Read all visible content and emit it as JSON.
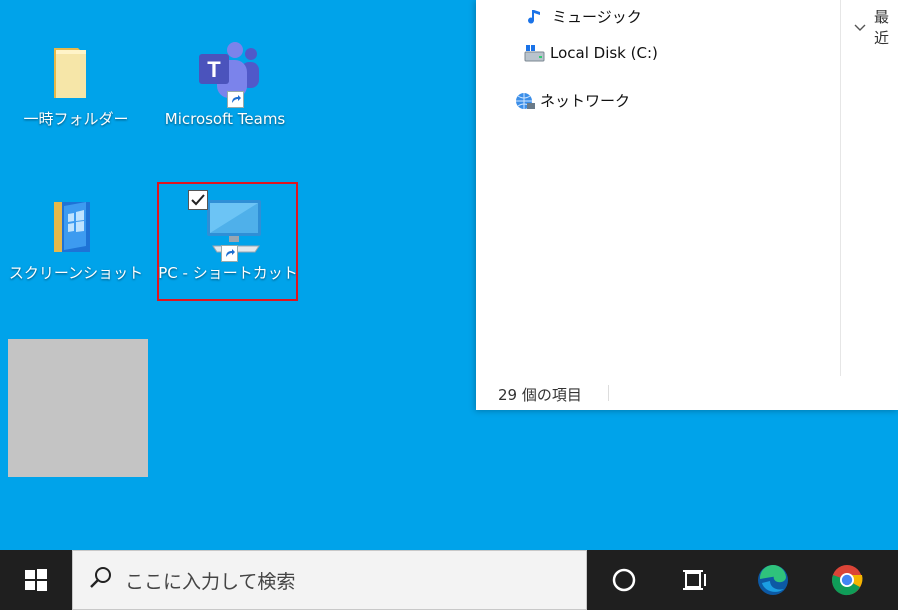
{
  "desktop": {
    "icons": [
      {
        "label": "一時フォルダー"
      },
      {
        "label": "Microsoft Teams"
      },
      {
        "label": "スクリーンショット"
      },
      {
        "label": "PC - ショートカット"
      }
    ]
  },
  "explorer": {
    "nav_items": [
      {
        "label": "ミュージック",
        "icon": "music-note-icon"
      },
      {
        "label": "Local Disk (C:)",
        "icon": "drive-icon"
      },
      {
        "label": "ネットワーク",
        "icon": "network-icon"
      }
    ],
    "column_header": "最近",
    "status": "29 個の項目"
  },
  "taskbar": {
    "search_placeholder": "ここに入力して検索",
    "apps": [
      "cortana-icon",
      "task-view-icon",
      "edge-icon",
      "chrome-icon"
    ]
  },
  "colors": {
    "desktop_bg": "#00a3ea",
    "taskbar_bg": "#1f1f1f",
    "selection_border": "#e0141e"
  }
}
